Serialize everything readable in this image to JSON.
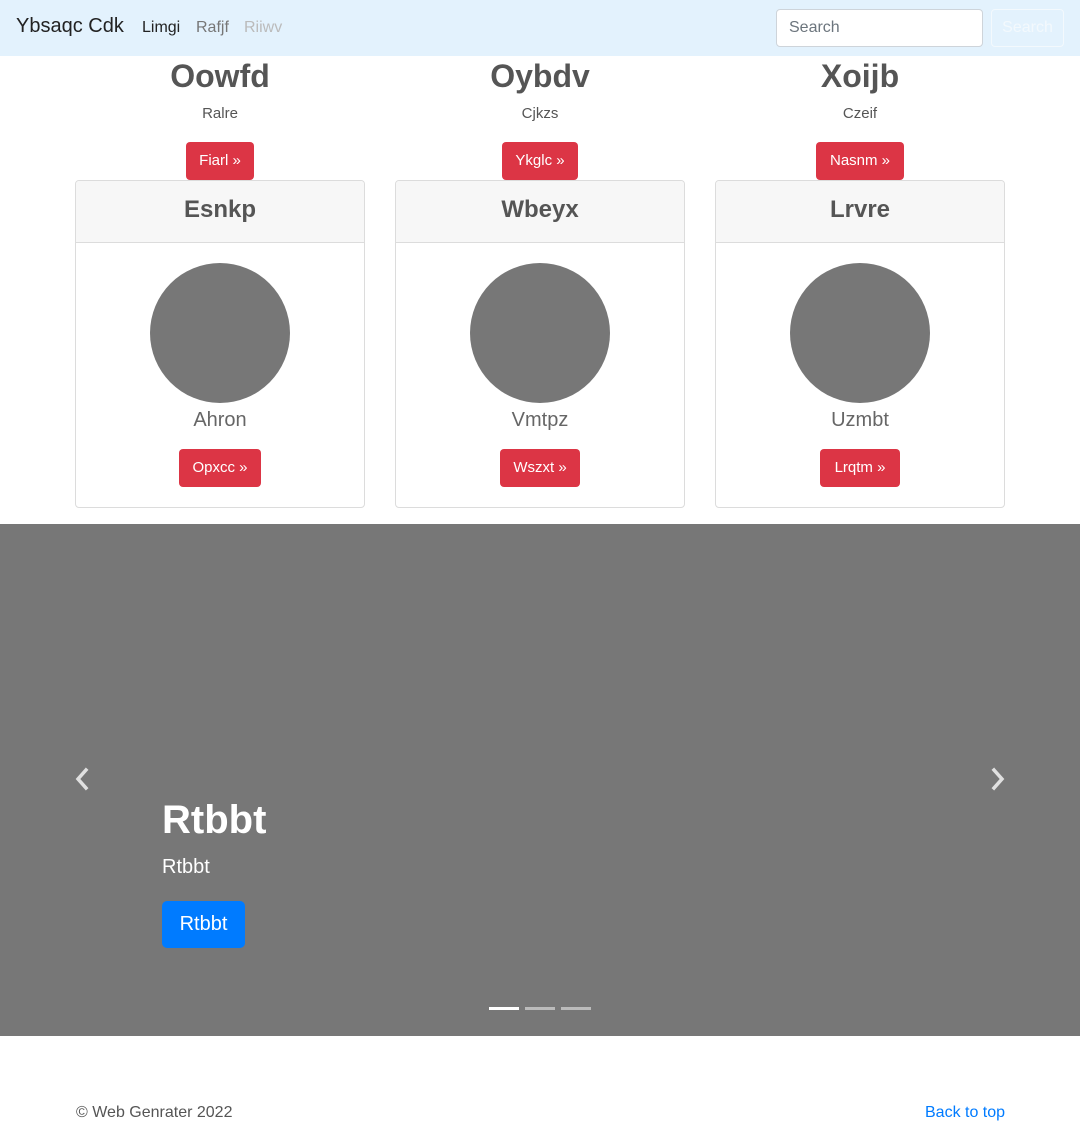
{
  "navbar": {
    "brand": "Ybsaqc Cdk",
    "links": [
      "Limgi",
      "Rafjf",
      "Riiwv"
    ],
    "search_placeholder": "Search",
    "search_button": "Search"
  },
  "columns": [
    {
      "title": "Oowfd",
      "subtitle": "Ralre",
      "button": "Fiarl »"
    },
    {
      "title": "Oybdv",
      "subtitle": "Cjkzs",
      "button": "Ykglc »"
    },
    {
      "title": "Xoijb",
      "subtitle": "Czeif",
      "button": "Nasnm »"
    }
  ],
  "cards": [
    {
      "header": "Esnkp",
      "name": "Ahron",
      "button": "Opxcc »"
    },
    {
      "header": "Wbeyx",
      "name": "Vmtpz",
      "button": "Wszxt »"
    },
    {
      "header": "Lrvre",
      "name": "Uzmbt",
      "button": "Lrqtm »"
    }
  ],
  "carousel": {
    "title": "Rtbbt",
    "subtitle": "Rtbbt",
    "button": "Rtbbt",
    "prev_icon": "chevron-left-icon",
    "next_icon": "chevron-right-icon",
    "slide_count": 3,
    "active_slide": 1
  },
  "footer": {
    "copyright": "© Web Genrater 2022",
    "back_to_top": "Back to top"
  },
  "colors": {
    "navbar_bg": "#e3f2fd",
    "danger": "#dc3545",
    "primary": "#007bff",
    "carousel_bg": "#777777"
  }
}
